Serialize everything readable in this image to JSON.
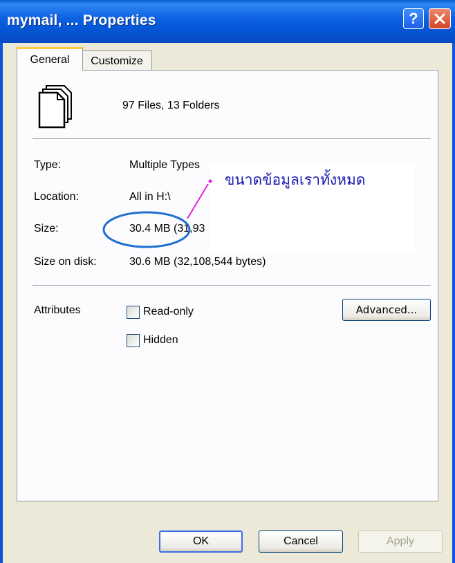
{
  "window": {
    "title": "mymail, ... Properties",
    "help_glyph": "?",
    "close_icon": "close-icon"
  },
  "tabs": [
    {
      "label": "General",
      "active": true
    },
    {
      "label": "Customize",
      "active": false
    }
  ],
  "general": {
    "summary": "97 Files, 13 Folders",
    "icon": "multiple-files-icon",
    "properties": [
      {
        "label": "Type:",
        "value": "Multiple Types"
      },
      {
        "label": "Location:",
        "value": "All in H:\\"
      },
      {
        "label": "Size:",
        "value": "30.4 MB (31,93"
      },
      {
        "label": "Size on disk:",
        "value": "30.6 MB (32,108,544 bytes)"
      }
    ],
    "annotation": "ขนาดข้อมูลเราทั้งหมด",
    "attributes_label": "Attributes",
    "checkboxes": [
      {
        "label": "Read-only",
        "checked": false
      },
      {
        "label": "Hidden",
        "checked": false
      }
    ],
    "advanced_button": "Advanced..."
  },
  "footer": {
    "ok": "OK",
    "cancel": "Cancel",
    "apply": "Apply",
    "apply_enabled": false
  },
  "colors": {
    "titlebar": "#0b5fe0",
    "accent_tab": "#ffc73c",
    "annotation_text": "#1a1ab0",
    "annotation_ellipse": "#1e6fd0",
    "annotation_pointer": "#e020e0"
  }
}
